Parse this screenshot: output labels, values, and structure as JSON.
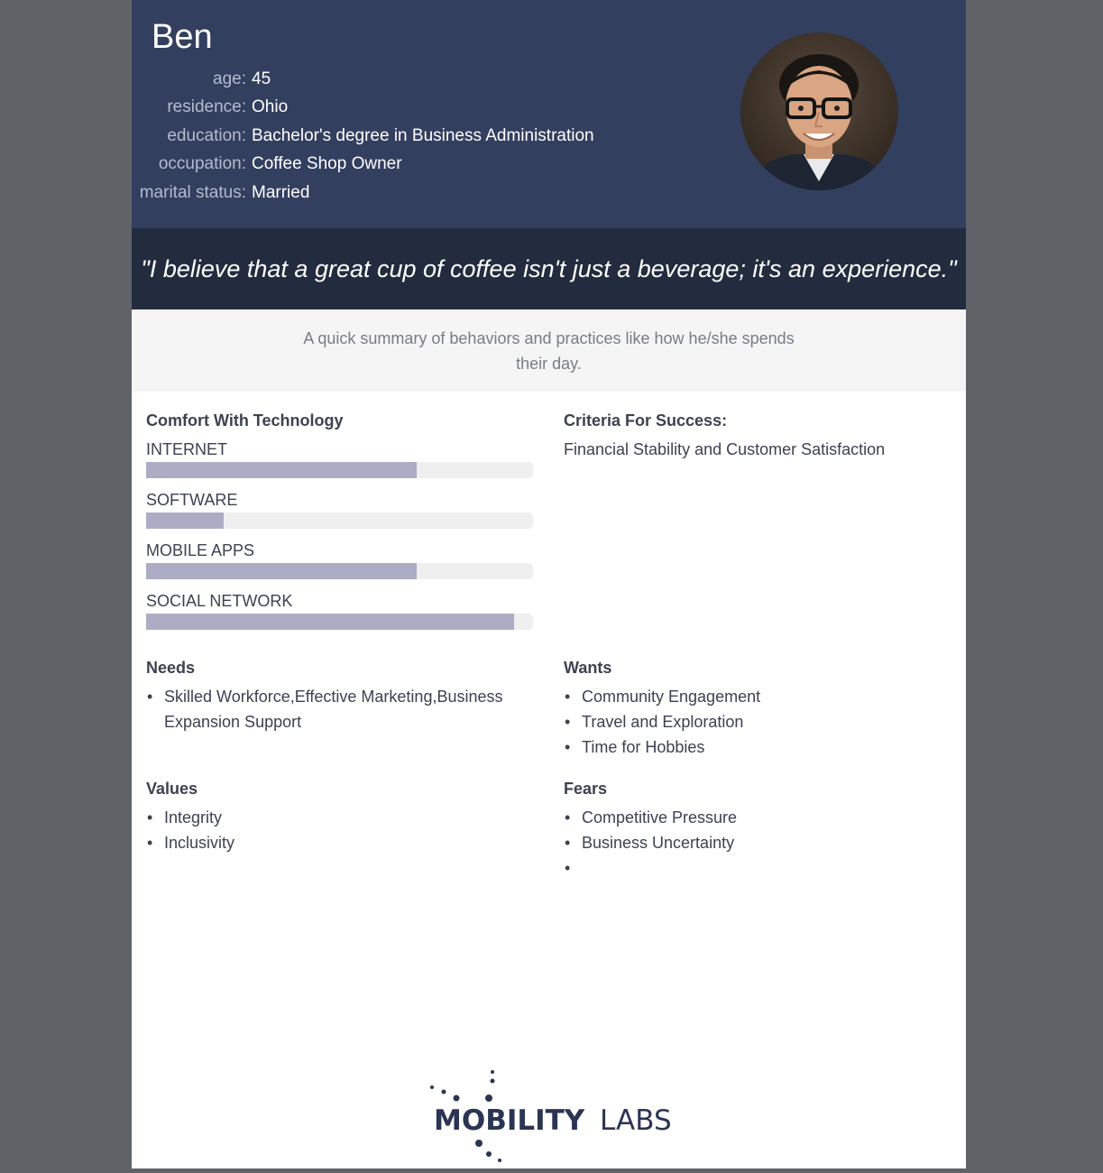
{
  "persona": {
    "name": "Ben",
    "attributes": [
      {
        "label": "age:",
        "value": "45"
      },
      {
        "label": "residence:",
        "value": "Ohio"
      },
      {
        "label": "education:",
        "value": "Bachelor's degree in Business Administration"
      },
      {
        "label": "occupation:",
        "value": "Coffee Shop Owner"
      },
      {
        "label": "marital status:",
        "value": "Married"
      }
    ],
    "quote": "\"I believe that a great cup of coffee isn't just a beverage; it's an experience.\"",
    "summary": "A quick summary of behaviors and practices like how he/she spends their day."
  },
  "technology": {
    "title": "Comfort With Technology",
    "items": [
      {
        "label": "INTERNET",
        "level": 0.7
      },
      {
        "label": "SOFTWARE",
        "level": 0.2
      },
      {
        "label": "MOBILE APPS",
        "level": 0.7
      },
      {
        "label": "SOCIAL NETWORK",
        "level": 0.95
      }
    ]
  },
  "criteria": {
    "title": "Criteria For Success:",
    "text": "Financial Stability and Customer Satisfaction"
  },
  "needs": {
    "title": "Needs",
    "items": [
      "Skilled Workforce,Effective Marketing,Business Expansion Support"
    ]
  },
  "wants": {
    "title": "Wants",
    "items": [
      "Community Engagement",
      "Travel and Exploration",
      "Time for Hobbies"
    ]
  },
  "values": {
    "title": "Values",
    "items": [
      "Integrity",
      "Inclusivity"
    ]
  },
  "fears": {
    "title": "Fears",
    "items": [
      "Competitive Pressure",
      "Business Uncertainty",
      ""
    ]
  },
  "logo": {
    "text_bold": "MOBILITY",
    "text_light": "LABS",
    "color": "#2b3553"
  },
  "colors": {
    "header": "#333f5f",
    "quote_band": "#232c3f",
    "bar_fill": "#acadc4",
    "bar_track": "#efefef"
  }
}
